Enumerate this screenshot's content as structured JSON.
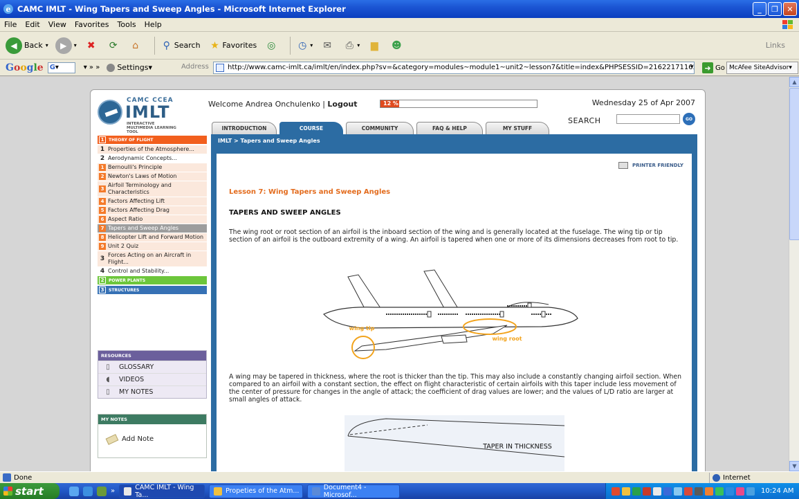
{
  "window": {
    "title": "CAMC IMLT - Wing Tapers and Sweep Angles - Microsoft Internet Explorer"
  },
  "menu": [
    "File",
    "Edit",
    "View",
    "Favorites",
    "Tools",
    "Help"
  ],
  "toolbar": {
    "back": "Back",
    "search": "Search",
    "favorites": "Favorites",
    "links": "Links"
  },
  "addressbar": {
    "google_settings": "Settings",
    "address_label": "Address",
    "url": "http://www.camc-imlt.ca/imlt/en/index.php?sv=&category=modules~module1~unit2~lesson7&title=index&PHPSESSID=21622171163",
    "go": "Go",
    "mcafee": "McAfee SiteAdvisor"
  },
  "site": {
    "logo": {
      "camc": "CAMC CCEA",
      "imlt": "IMLT",
      "tagline": "INTERACTIVE MULTIMEDIA LEARNING TOOL"
    },
    "welcome_prefix": "Welcome Andrea Onchulenko | ",
    "logout": "Logout",
    "progress": {
      "label": "12 %",
      "fraction": 0.12
    },
    "date": "Wednesday 25 of Apr 2007",
    "search_label": "SEARCH",
    "search_go": "GO",
    "tabs": [
      {
        "label": "INTRODUCTION"
      },
      {
        "label": "COURSE"
      },
      {
        "label": "COMMUNITY"
      },
      {
        "label": "FAQ & HELP"
      },
      {
        "label": "MY STUFF"
      }
    ],
    "nav": {
      "section1_num": "1",
      "section1": "THEORY OF FLIGHT",
      "items": [
        {
          "num": "1",
          "label": "Properties of the Atmosphere..."
        },
        {
          "num": "2",
          "label": "Aerodynamic Concepts..."
        },
        {
          "num": "1",
          "label": "Bernoulli's Principle"
        },
        {
          "num": "2",
          "label": "Newton's Laws of Motion"
        },
        {
          "num": "3",
          "label": "Airfoil Terminology and Characteristics"
        },
        {
          "num": "4",
          "label": "Factors Affecting Lift"
        },
        {
          "num": "5",
          "label": "Factors Affecting Drag"
        },
        {
          "num": "6",
          "label": "Aspect Ratio"
        },
        {
          "num": "7",
          "label": "Tapers and Sweep Angles"
        },
        {
          "num": "8",
          "label": "Helicopter Lift and Forward Motion"
        },
        {
          "num": "9",
          "label": "Unit 2 Quiz"
        },
        {
          "num": "3",
          "label": "Forces Acting on an Aircraft in Flight..."
        },
        {
          "num": "4",
          "label": "Control and Stability..."
        }
      ],
      "section2_num": "2",
      "section2": "POWER PLANTS",
      "section3_num": "3",
      "section3": "STRUCTURES"
    },
    "resources": {
      "title": "RESOURCES",
      "items": [
        "GLOSSARY",
        "VIDEOS",
        "MY NOTES"
      ]
    },
    "mynotes": {
      "title": "MY NOTES",
      "add": "Add Note"
    },
    "content": {
      "breadcrumb": "IMLT > Tapers and Sweep Angles",
      "printer": "PRINTER FRIENDLY",
      "lesson_title": "Lesson 7: Wing Tapers and Sweep Angles",
      "section_title": "TAPERS AND SWEEP ANGLES",
      "para1": "The wing root or root section of an airfoil is the inboard section of the wing and is generally located at the fuselage. The wing tip or tip section of an airfoil is the outboard extremity of a wing. An airfoil is tapered when one or more of its dimensions decreases from root to tip.",
      "wing_tip": "wing tip",
      "wing_root": "wing root",
      "para2": "A wing may be tapered in thickness, where the root is thicker than the tip. This may also include a constantly changing airfoil section. When compared to an airfoil with a constant section, the effect on flight characteristic of certain airfoils with this taper include less movement of the center of pressure for changes in the angle of attack; the coefficient of drag values are lower; and the values of L/D ratio are larger at small angles of attack.",
      "taper_label": "TAPER IN THICKNESS"
    }
  },
  "statusbar": {
    "status": "Done",
    "zone": "Internet"
  },
  "taskbar": {
    "start": "start",
    "tasks": [
      "CAMC IMLT - Wing Ta...",
      "Propeties of the Atm...",
      "Document4 - Microsof..."
    ],
    "clock": "10:24 AM"
  }
}
